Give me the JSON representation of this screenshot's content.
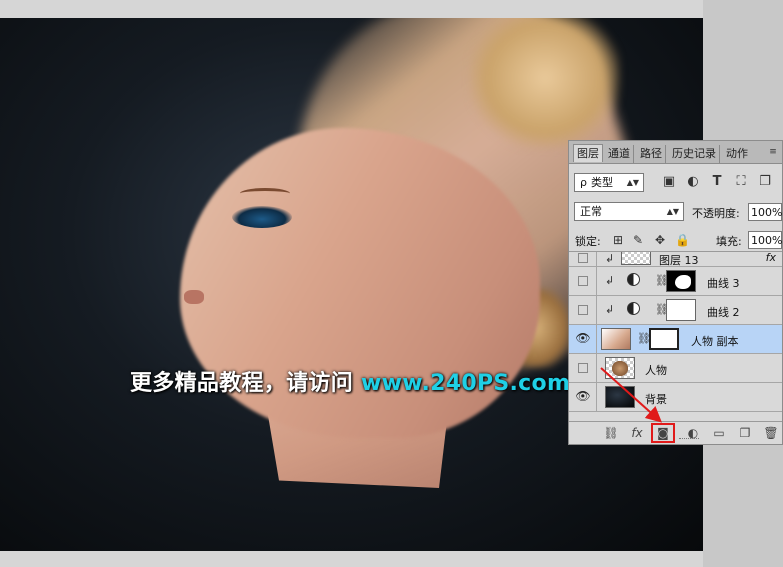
{
  "watermark": {
    "cn": "更多精品教程，请访问",
    "url": "www.240PS.com"
  },
  "panel": {
    "tabs": [
      "图层",
      "通道",
      "路径",
      "历史记录",
      "动作"
    ],
    "menu_glyph": "≡",
    "filter": {
      "prefix": "ρ",
      "value": "类型"
    },
    "filter_icons": [
      "image-icon",
      "adjustment-icon",
      "type-icon",
      "transform-icon",
      "smart-object-icon"
    ],
    "blend_mode": "正常",
    "opacity_label": "不透明度:",
    "opacity_value": "100%",
    "lock_label": "锁定:",
    "fill_label": "填充:",
    "fill_value": "100%",
    "layers": [
      {
        "name": "图层 13",
        "visible": false,
        "clipped": true,
        "fx": "fx"
      },
      {
        "name": "曲线 3",
        "visible": false,
        "clipped": true
      },
      {
        "name": "曲线 2",
        "visible": false,
        "clipped": true
      },
      {
        "name": "人物 副本",
        "visible": true,
        "selected": true
      },
      {
        "name": "人物",
        "visible": false
      },
      {
        "name": "背景",
        "visible": true
      }
    ],
    "bottom_icons": [
      "link-icon",
      "fx-icon",
      "add-mask-icon",
      "adjustment-layer-icon",
      "folder-icon",
      "new-layer-icon",
      "trash-icon"
    ]
  },
  "colors": {
    "highlight": "#e01a1a",
    "selected_layer": "#b8d4f6",
    "url": "#1fd0e6"
  }
}
